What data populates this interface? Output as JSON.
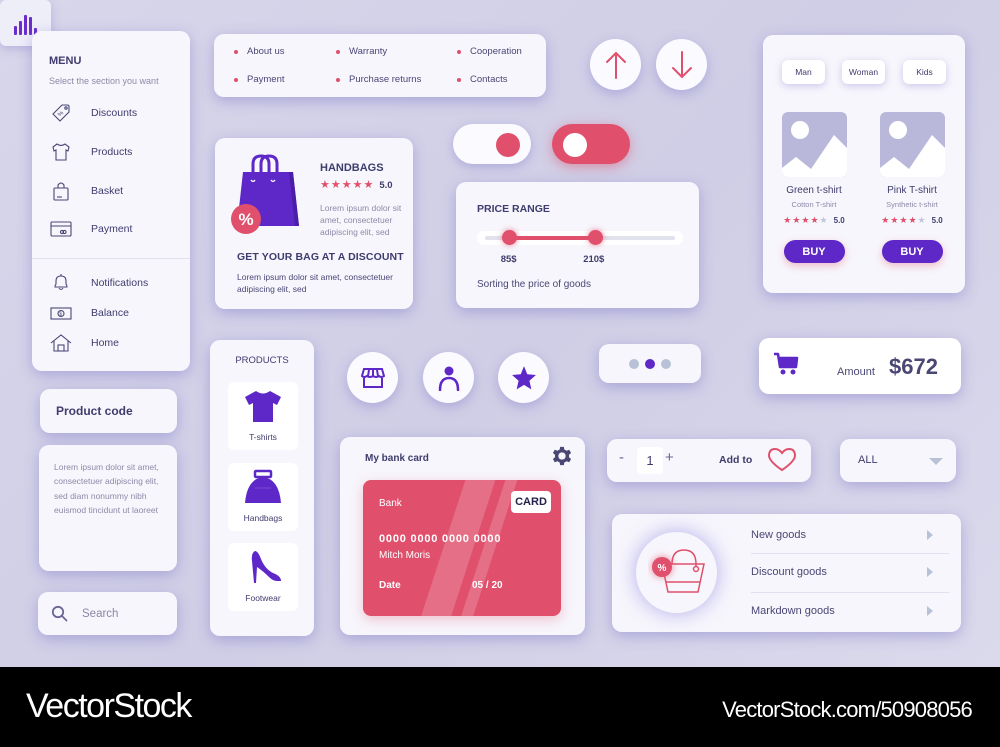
{
  "menu": {
    "title": "MENU",
    "subtitle": "Select the section you want",
    "items": [
      {
        "label": "Discounts",
        "icon": "discount-tag-icon"
      },
      {
        "label": "Products",
        "icon": "tshirt-icon"
      },
      {
        "label": "Basket",
        "icon": "shopping-bag-icon"
      },
      {
        "label": "Payment",
        "icon": "credit-card-icon"
      },
      {
        "label": "Notifications",
        "icon": "bell-icon"
      },
      {
        "label": "Balance",
        "icon": "banknote-icon"
      },
      {
        "label": "Home",
        "icon": "home-icon"
      }
    ]
  },
  "links": [
    "About us",
    "Warranty",
    "Cooperation",
    "Payment",
    "Purchase returns",
    "Contacts"
  ],
  "handbags": {
    "title": "HANDBAGS",
    "rating": "5.0",
    "stars": 5,
    "description": "Lorem ipsum dolor sit amet, consectetuer adipiscing elit, sed",
    "headline": "GET YOUR BAG AT A DISCOUNT",
    "body": "Lorem ipsum dolor sit amet, consectetuer adipiscing elit, sed",
    "badge": "%"
  },
  "arrows": {
    "up": "arrow-up-icon",
    "down": "arrow-down-icon"
  },
  "toggles": [
    {
      "state": "on",
      "style": "light"
    },
    {
      "state": "off",
      "style": "accent"
    }
  ],
  "chart_button": {
    "bars": [
      0.45,
      0.7,
      1.0,
      0.9,
      0.35
    ]
  },
  "price_range": {
    "title": "PRICE RANGE",
    "min_label": "85$",
    "max_label": "210$",
    "low_fraction": 0.13,
    "high_fraction": 0.58,
    "caption": "Sorting the price of goods"
  },
  "shop": {
    "filters": [
      "Man",
      "Woman",
      "Kids"
    ],
    "products": [
      {
        "name": "Green t-shirt",
        "subtitle": "Cotton T-shirt",
        "stars": 4,
        "rating": "5.0",
        "button": "BUY"
      },
      {
        "name": "Pink T-shirt",
        "subtitle": "Synthetic t-shirt",
        "stars": 4,
        "rating": "5.0",
        "button": "BUY"
      }
    ]
  },
  "product_code": {
    "label": "Product code"
  },
  "lorem_card": {
    "text": "Lorem ipsum dolor sit amet, consectetuer adipiscing elit, sed diam nonummy nibh euismod tincidunt ut laoreet"
  },
  "search": {
    "placeholder": "Search",
    "value": ""
  },
  "categories": {
    "title": "PRODUCTS",
    "items": [
      {
        "label": "T-shirts"
      },
      {
        "label": "Handbags"
      },
      {
        "label": "Footwear"
      }
    ]
  },
  "round_icons": [
    "store-icon",
    "user-icon",
    "star-icon"
  ],
  "bank_card": {
    "title": "My bank card",
    "bank": "Bank",
    "badge": "CARD",
    "number": "0000 0000 0000 0000",
    "holder": "Mitch Moris",
    "date_label": "Date",
    "date_value": "05 / 20"
  },
  "pager": {
    "count": 3,
    "active": 1
  },
  "amount": {
    "label": "Amount",
    "value": "$672"
  },
  "quantity": {
    "minus": "-",
    "value": "1",
    "plus": "+",
    "add_label": "Add to"
  },
  "dropdown": {
    "selected": "ALL"
  },
  "goods": {
    "badge": "%",
    "items": [
      "New goods",
      "Discount goods",
      "Markdown goods"
    ]
  },
  "footer": {
    "brand": "VectorStock",
    "id": "VectorStock.com/50908056"
  },
  "colors": {
    "accent": "#e0506c",
    "primary": "#5e28c8",
    "text": "#3f3c6e",
    "muted": "#8d8aa8",
    "background": "#d6d4ea"
  }
}
